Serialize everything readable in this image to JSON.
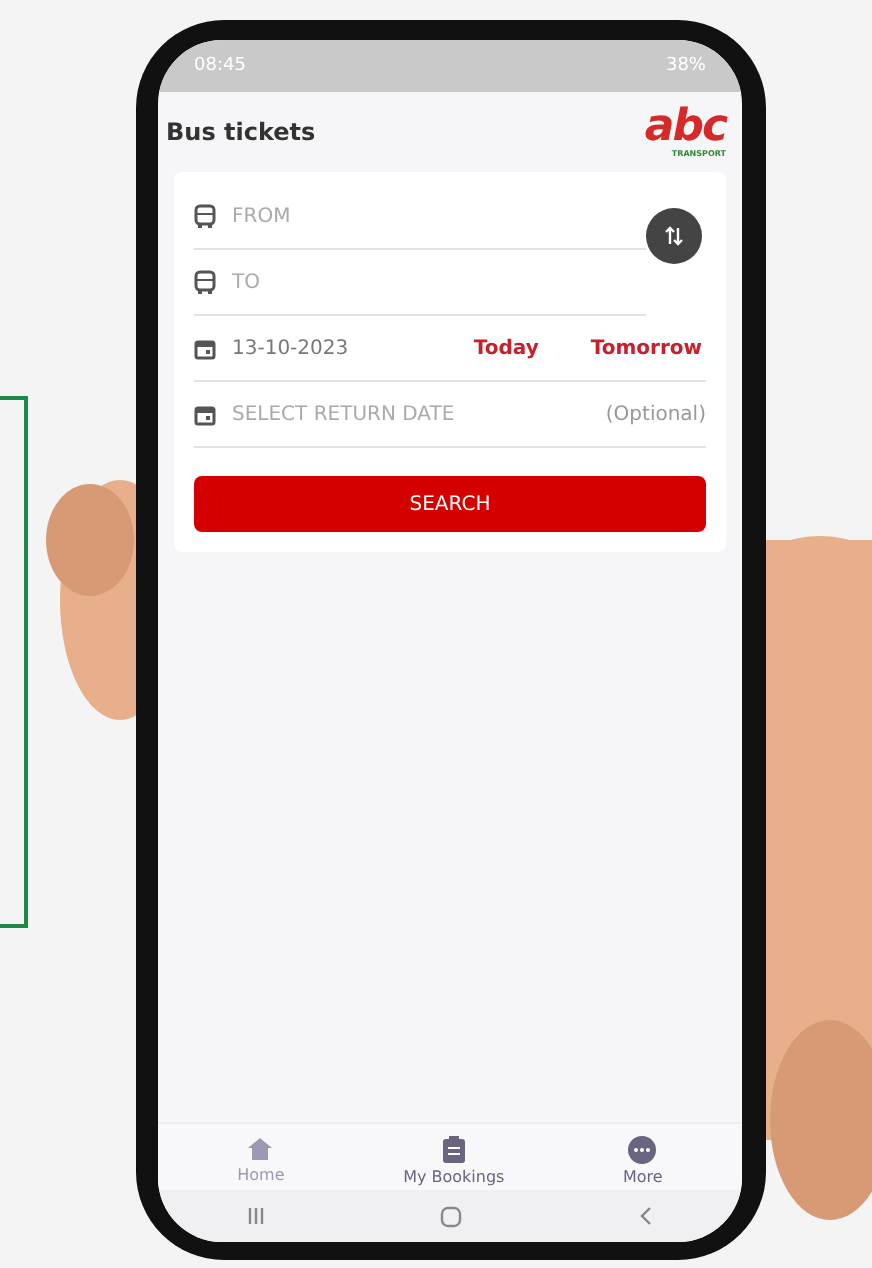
{
  "status_bar": {
    "time": "08:45",
    "battery": "38%"
  },
  "header": {
    "title": "Bus tickets",
    "logo": "abc",
    "logo_sub": "TRANSPORT"
  },
  "form": {
    "fields": [
      {
        "kind": "place",
        "placeholder": "FROM"
      },
      {
        "kind": "place",
        "placeholder": "TO"
      },
      {
        "kind": "date",
        "value": "13-10-2023",
        "quick": [
          "Today",
          "Tomorrow"
        ]
      },
      {
        "kind": "return",
        "placeholder": "SELECT RETURN DATE",
        "note": "(Optional)"
      }
    ],
    "button": "SEARCH"
  },
  "bottom_nav": [
    {
      "label": "Home",
      "kind": "home",
      "selected": true
    },
    {
      "label": "My Bookings",
      "kind": "clipboard",
      "selected": false
    },
    {
      "label": "More",
      "kind": "more",
      "selected": false
    }
  ]
}
